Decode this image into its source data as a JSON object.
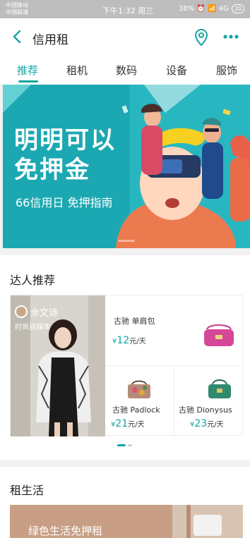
{
  "status_bar": {
    "left_line1": "中国移动",
    "left_line2": "中国联通",
    "time": "下午1:32 周三",
    "right": "38% ⏰ 📶 4G",
    "battery": "20"
  },
  "nav": {
    "title": "信用租"
  },
  "tabs": [
    {
      "label": "推荐",
      "active": true
    },
    {
      "label": "租机"
    },
    {
      "label": "数码"
    },
    {
      "label": "设备"
    },
    {
      "label": "服饰"
    }
  ],
  "banner": {
    "headline": "明明可以\n免押金",
    "subtitle": "66信用日 免押指南",
    "accent_color": "#1ba8b2"
  },
  "experts": {
    "title": "达人推荐",
    "name": "余文诗",
    "tag": "时尚自媒体",
    "items": [
      {
        "name": "古驰 单肩包",
        "currency": "¥",
        "price": "12",
        "unit": "元/天"
      },
      {
        "name": "古驰 Padlock",
        "currency": "¥",
        "price": "21",
        "unit": "元/天"
      },
      {
        "name": "古驰 Dionysus",
        "currency": "¥",
        "price": "23",
        "unit": "元/天"
      }
    ]
  },
  "life": {
    "title": "租生活",
    "banner_text": "绿色生活免押租"
  }
}
